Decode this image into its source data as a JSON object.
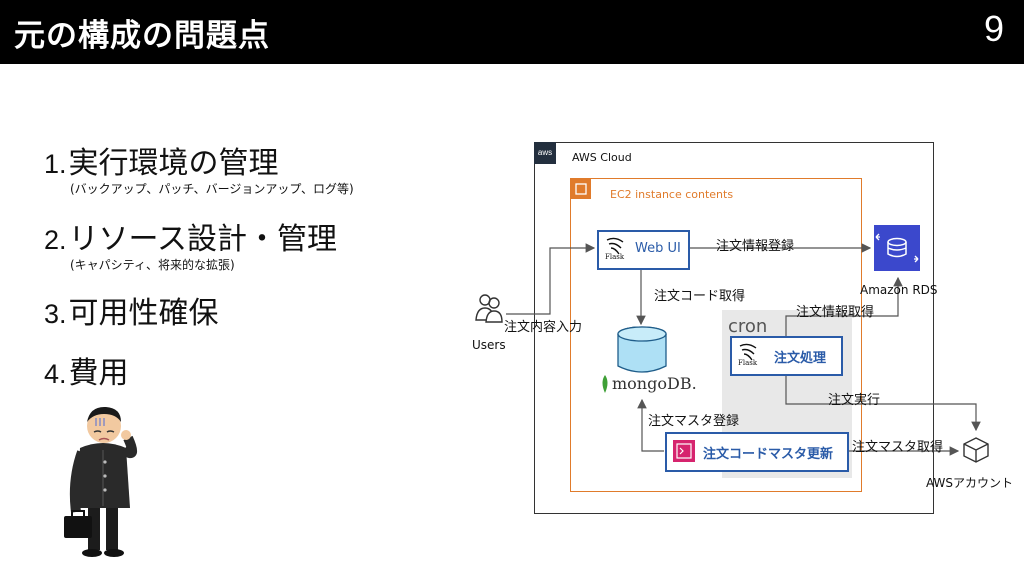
{
  "header": {
    "title": "元の構成の問題点",
    "page_number": "9"
  },
  "problems": [
    {
      "num": "1.",
      "label": "実行環境の管理",
      "detail": "(バックアップ、パッチ、バージョンアップ、ログ等)"
    },
    {
      "num": "2.",
      "label": "リソース設計・管理",
      "detail": "(キャパシティ、将来的な拡張)"
    },
    {
      "num": "3.",
      "label": "可用性確保"
    },
    {
      "num": "4.",
      "label": "費用"
    }
  ],
  "diagram": {
    "aws_cloud_label": "AWS Cloud",
    "aws_badge": "aws",
    "ec2_label": "EC2 instance contents",
    "cron_label": "cron",
    "users_label": "Users",
    "users_input_label": "注文内容入力",
    "webui": {
      "label": "Web UI",
      "framework": "Flask"
    },
    "order_proc": {
      "label": "注文処理",
      "framework": "Flask"
    },
    "code_master": {
      "label": "注文コードマスタ更新"
    },
    "mongodb_label": "mongoDB.",
    "rds_label": "Amazon RDS",
    "aws_account_label": "AWSアカウント",
    "edges": {
      "order_register": "注文情報登録",
      "code_get": "注文コード取得",
      "order_get": "注文情報取得",
      "order_exec": "注文実行",
      "master_register": "注文マスタ登録",
      "master_get": "注文マスタ取得"
    }
  }
}
